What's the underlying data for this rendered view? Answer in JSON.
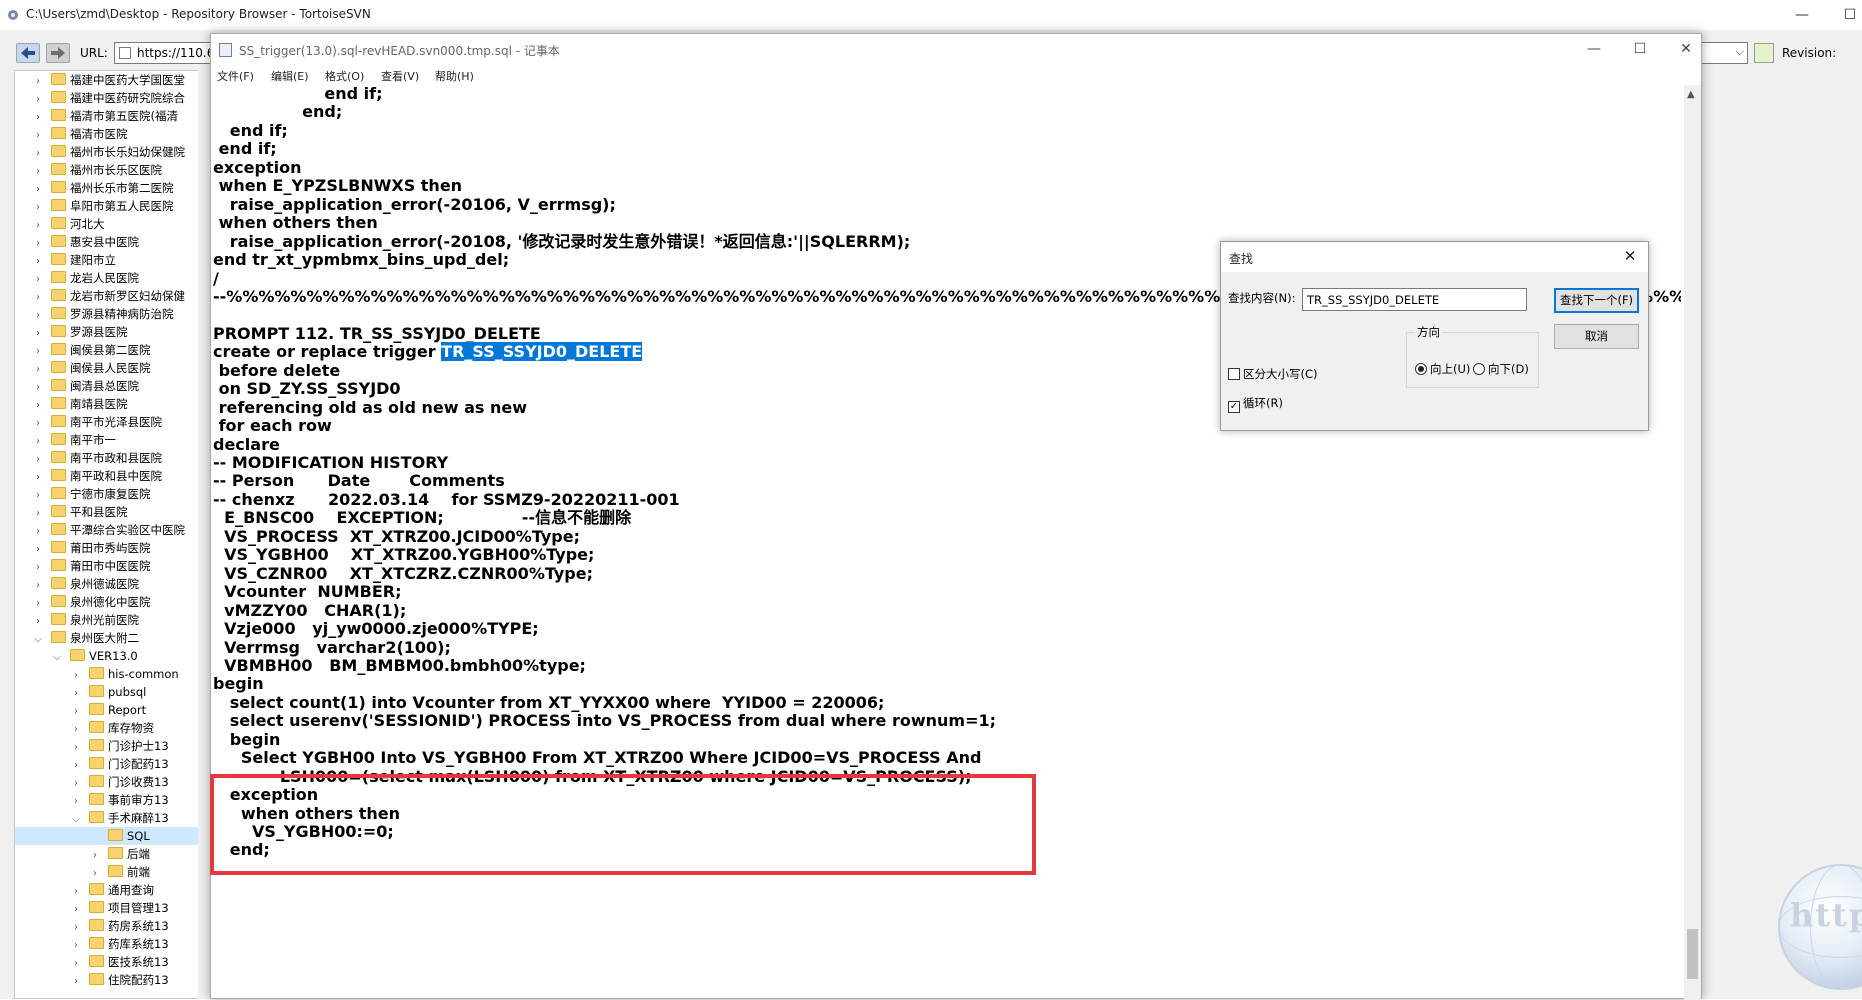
{
  "repo_window": {
    "title": "C:\\Users\\zmd\\Desktop - Repository Browser - TortoiseSVN",
    "url_label": "URL:",
    "url_value": "https://110.6",
    "revision_label": "Revision:",
    "tree": [
      {
        "label": "福建中医药大学国医堂",
        "depth": 0,
        "expanded": false
      },
      {
        "label": "福建中医药研究院综合",
        "depth": 0,
        "expanded": false
      },
      {
        "label": "福清市第五医院(福清",
        "depth": 0,
        "expanded": false
      },
      {
        "label": "福清市医院",
        "depth": 0,
        "expanded": false
      },
      {
        "label": "福州市长乐妇幼保健院",
        "depth": 0,
        "expanded": false
      },
      {
        "label": "福州市长乐区医院",
        "depth": 0,
        "expanded": false
      },
      {
        "label": "福州长乐市第二医院",
        "depth": 0,
        "expanded": false
      },
      {
        "label": "阜阳市第五人民医院",
        "depth": 0,
        "expanded": false
      },
      {
        "label": "河北大",
        "depth": 0,
        "expanded": false
      },
      {
        "label": "惠安县中医院",
        "depth": 0,
        "expanded": false
      },
      {
        "label": "建阳市立",
        "depth": 0,
        "expanded": false
      },
      {
        "label": "龙岩人民医院",
        "depth": 0,
        "expanded": false
      },
      {
        "label": "龙岩市新罗区妇幼保健",
        "depth": 0,
        "expanded": false
      },
      {
        "label": "罗源县精神病防治院",
        "depth": 0,
        "expanded": false
      },
      {
        "label": "罗源县医院",
        "depth": 0,
        "expanded": false
      },
      {
        "label": "闽侯县第二医院",
        "depth": 0,
        "expanded": false
      },
      {
        "label": "闽侯县人民医院",
        "depth": 0,
        "expanded": false
      },
      {
        "label": "闽清县总医院",
        "depth": 0,
        "expanded": false
      },
      {
        "label": "南靖县医院",
        "depth": 0,
        "expanded": false
      },
      {
        "label": "南平市光泽县医院",
        "depth": 0,
        "expanded": false
      },
      {
        "label": "南平市一",
        "depth": 0,
        "expanded": false
      },
      {
        "label": "南平市政和县医院",
        "depth": 0,
        "expanded": false
      },
      {
        "label": "南平政和县中医院",
        "depth": 0,
        "expanded": false
      },
      {
        "label": "宁德市康复医院",
        "depth": 0,
        "expanded": false
      },
      {
        "label": "平和县医院",
        "depth": 0,
        "expanded": false
      },
      {
        "label": "平潭综合实验区中医院",
        "depth": 0,
        "expanded": false
      },
      {
        "label": "莆田市秀屿医院",
        "depth": 0,
        "expanded": false
      },
      {
        "label": "莆田市中医医院",
        "depth": 0,
        "expanded": false
      },
      {
        "label": "泉州德诚医院",
        "depth": 0,
        "expanded": false
      },
      {
        "label": "泉州德化中医院",
        "depth": 0,
        "expanded": false
      },
      {
        "label": "泉州光前医院",
        "depth": 0,
        "expanded": false
      },
      {
        "label": "泉州医大附二",
        "depth": 0,
        "expanded": true
      },
      {
        "label": "VER13.0",
        "depth": 1,
        "expanded": true
      },
      {
        "label": "his-common",
        "depth": 2,
        "expanded": false
      },
      {
        "label": "pubsql",
        "depth": 2,
        "expanded": false
      },
      {
        "label": "Report",
        "depth": 2,
        "expanded": false
      },
      {
        "label": "库存物资",
        "depth": 2,
        "expanded": false
      },
      {
        "label": "门诊护士13",
        "depth": 2,
        "expanded": false
      },
      {
        "label": "门诊配药13",
        "depth": 2,
        "expanded": false
      },
      {
        "label": "门诊收费13",
        "depth": 2,
        "expanded": false
      },
      {
        "label": "事前审方13",
        "depth": 2,
        "expanded": false
      },
      {
        "label": "手术麻醉13",
        "depth": 2,
        "expanded": true
      },
      {
        "label": "SQL",
        "depth": 3,
        "expanded": false,
        "leaf": true,
        "selected": true
      },
      {
        "label": "后端",
        "depth": 3,
        "expanded": false
      },
      {
        "label": "前端",
        "depth": 3,
        "expanded": false
      },
      {
        "label": "通用查询",
        "depth": 2,
        "expanded": false
      },
      {
        "label": "项目管理13",
        "depth": 2,
        "expanded": false
      },
      {
        "label": "药房系统13",
        "depth": 2,
        "expanded": false
      },
      {
        "label": "药库系统13",
        "depth": 2,
        "expanded": false
      },
      {
        "label": "医技系统13",
        "depth": 2,
        "expanded": false
      },
      {
        "label": "住院配药13",
        "depth": 2,
        "expanded": false
      }
    ],
    "watermark_text": "http"
  },
  "notepad": {
    "title": "SS_trigger(13.0).sql-revHEAD.svn000.tmp.sql - 记事本",
    "menu": [
      "文件(F)",
      "编辑(E)",
      "格式(O)",
      "查看(V)",
      "帮助(H)"
    ],
    "lines": [
      {
        "text": "                    end if;"
      },
      {
        "text": "                end;"
      },
      {
        "text": "   end if;"
      },
      {
        "text": " end if;"
      },
      {
        "text": "exception"
      },
      {
        "text": " when E_YPZSLBNWXS then"
      },
      {
        "text": "   raise_application_error(-20106, V_errmsg);"
      },
      {
        "text": " when others then"
      },
      {
        "text": "   raise_application_error(-20108, '修改记录时发生意外错误！*返回信息:'||SQLERRM);"
      },
      {
        "text": "end tr_xt_ypmbmx_bins_upd_del;"
      },
      {
        "text": "/"
      },
      {
        "text": "--%%%%%%%%%%%%%%%%%%%%%%%%%%%%%%%%%%%%%%%%%%%%%%%%%%%%%%%%%%%%%%%%%%%%%%%%%%%%%%%%%%%%%%%%%%%%%%%%%%%%%%%%%%%%%%%%%%%"
      },
      {
        "text": ""
      },
      {
        "text": "PROMPT 112. TR_SS_SSYJD0_DELETE"
      },
      {
        "text": "create or replace trigger ",
        "hl": "TR_SS_SSYJD0_DELETE"
      },
      {
        "text": " before delete"
      },
      {
        "text": " on SD_ZY.SS_SSYJD0"
      },
      {
        "text": " referencing old as old new as new"
      },
      {
        "text": " for each row"
      },
      {
        "text": "declare"
      },
      {
        "text": "-- MODIFICATION HISTORY"
      },
      {
        "text": "-- Person      Date       Comments"
      },
      {
        "text": "-- chenxz      2022.03.14    for SSMZ9-20220211-001"
      },
      {
        "text": "  E_BNSC00    EXCEPTION;              --信息不能删除"
      },
      {
        "text": "  VS_PROCESS  XT_XTRZ00.JCID00%Type;"
      },
      {
        "text": "  VS_YGBH00    XT_XTRZ00.YGBH00%Type;"
      },
      {
        "text": "  VS_CZNR00    XT_XTCZRZ.CZNR00%Type;"
      },
      {
        "text": "  Vcounter  NUMBER;"
      },
      {
        "text": "  vMZZY00   CHAR(1);"
      },
      {
        "text": "  Vzje000   yj_yw0000.zje000%TYPE;"
      },
      {
        "text": "  Verrmsg   varchar2(100);"
      },
      {
        "text": "  VBMBH00   BM_BMBM00.bmbh00%type;"
      },
      {
        "text": "begin"
      },
      {
        "text": "   select count(1) into Vcounter from XT_YYXX00 where  YYID00 = 220006;"
      },
      {
        "text": "   select userenv('SESSIONID') PROCESS into VS_PROCESS from dual where rownum=1;"
      },
      {
        "text": "   begin"
      },
      {
        "text": "     Select YGBH00 Into VS_YGBH00 From XT_XTRZ00 Where JCID00=VS_PROCESS And"
      },
      {
        "text": "            LSH000=(select max(LSH000) from XT_XTRZ00 where JCID00=VS_PROCESS);"
      },
      {
        "text": "   exception"
      },
      {
        "text": "     when others then"
      },
      {
        "text": "       VS_YGBH00:=0;"
      },
      {
        "text": "   end;"
      }
    ]
  },
  "find_dialog": {
    "title": "查找",
    "find_label": "查找内容(N):",
    "find_value": "TR_SS_SSYJD0_DELETE",
    "find_next_label": "查找下一个(F)",
    "cancel_label": "取消",
    "direction_label": "方向",
    "up_label": "向上(U)",
    "down_label": "向下(D)",
    "match_case_label": "区分大小写(C)",
    "match_case_checked": false,
    "wrap_label": "循环(R)",
    "wrap_checked": true,
    "direction": "up"
  },
  "colors": {
    "selection": "#0078d7",
    "annotation_box": "#e33a3e",
    "folder": "#f6d36c"
  }
}
